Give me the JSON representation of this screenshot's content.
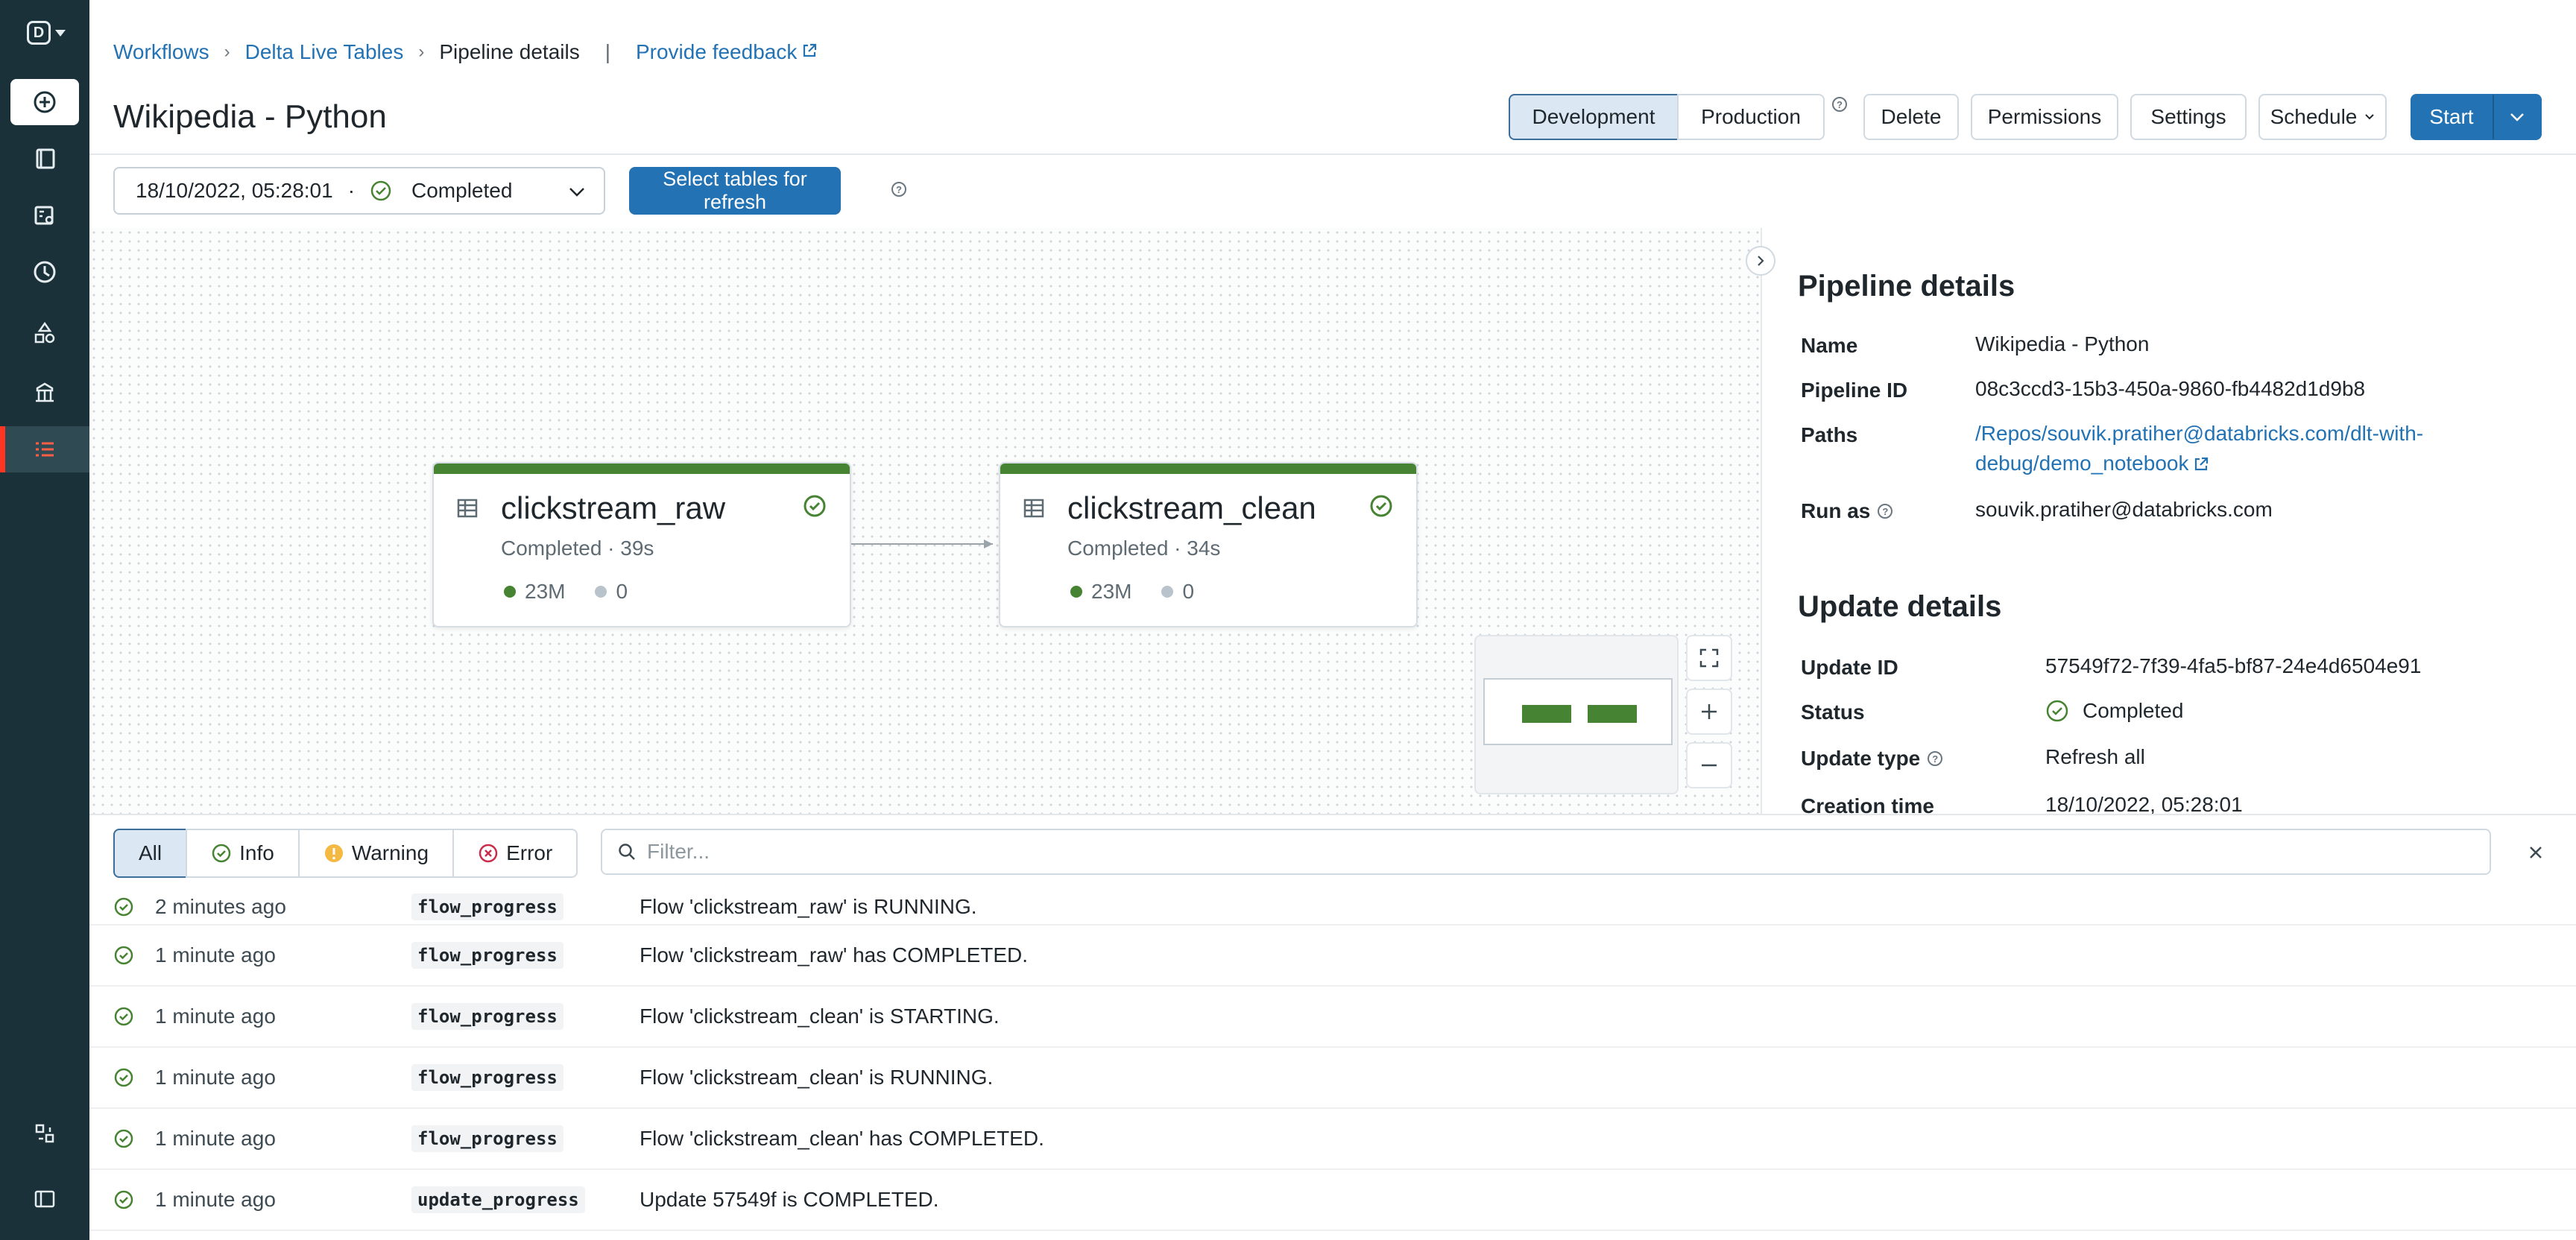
{
  "rail": {
    "logo": "D",
    "items": [
      "new",
      "workspace",
      "repos",
      "recents",
      "data",
      "compute",
      "workflows"
    ],
    "bottom": [
      "partner-connect",
      "collapse-menu"
    ]
  },
  "breadcrumb": {
    "items": [
      "Workflows",
      "Delta Live Tables"
    ],
    "current": "Pipeline details",
    "feedback": "Provide feedback"
  },
  "header": {
    "title": "Wikipedia - Python",
    "mode": {
      "development": "Development",
      "production": "Production",
      "selected": "Development"
    },
    "actions": {
      "delete": "Delete",
      "permissions": "Permissions",
      "settings": "Settings",
      "schedule": "Schedule",
      "start": "Start"
    }
  },
  "toolbar": {
    "run_datetime": "18/10/2022, 05:28:01",
    "run_separator": "·",
    "run_status": "Completed",
    "refresh_button": "Select tables for refresh"
  },
  "graph": {
    "nodes": [
      {
        "name": "clickstream_raw",
        "status": "Completed · 39s",
        "rows_written": "23M",
        "rows_dropped": "0"
      },
      {
        "name": "clickstream_clean",
        "status": "Completed · 34s",
        "rows_written": "23M",
        "rows_dropped": "0"
      }
    ],
    "colors": {
      "success": "#468332",
      "dropped": "#b9c3cb"
    }
  },
  "pipeline_details": {
    "heading": "Pipeline details",
    "name_label": "Name",
    "name": "Wikipedia - Python",
    "id_label": "Pipeline ID",
    "id": "08c3ccd3-15b3-450a-9860-fb4482d1d9b8",
    "paths_label": "Paths",
    "path_line1": "/Repos/souvik.pratiher@databricks.com/dlt-with-",
    "path_line2": "debug/demo_notebook",
    "run_as_label": "Run as",
    "run_as": "souvik.pratiher@databricks.com"
  },
  "update_details": {
    "heading": "Update details",
    "id_label": "Update ID",
    "id": "57549f72-7f39-4fa5-bf87-24e4d6504e91",
    "status_label": "Status",
    "status": "Completed",
    "type_label": "Update type",
    "type": "Refresh all",
    "creation_label": "Creation time",
    "creation": "18/10/2022, 05:28:01"
  },
  "log_filters": {
    "all": "All",
    "info": "Info",
    "warning": "Warning",
    "error": "Error",
    "selected": "All",
    "placeholder": "Filter..."
  },
  "logs": [
    {
      "time": "2 minutes ago",
      "type": "flow_progress",
      "message": "Flow 'clickstream_raw' is RUNNING."
    },
    {
      "time": "1 minute ago",
      "type": "flow_progress",
      "message": "Flow 'clickstream_raw' has COMPLETED."
    },
    {
      "time": "1 minute ago",
      "type": "flow_progress",
      "message": "Flow 'clickstream_clean' is STARTING."
    },
    {
      "time": "1 minute ago",
      "type": "flow_progress",
      "message": "Flow 'clickstream_clean' is RUNNING."
    },
    {
      "time": "1 minute ago",
      "type": "flow_progress",
      "message": "Flow 'clickstream_clean' has COMPLETED."
    },
    {
      "time": "1 minute ago",
      "type": "update_progress",
      "message": "Update 57549f is COMPLETED."
    }
  ],
  "colors": {
    "accent": "#2272b4",
    "rail": "#1b3139",
    "success": "#468332",
    "warning": "#f4b942",
    "error": "#c82d4c"
  }
}
